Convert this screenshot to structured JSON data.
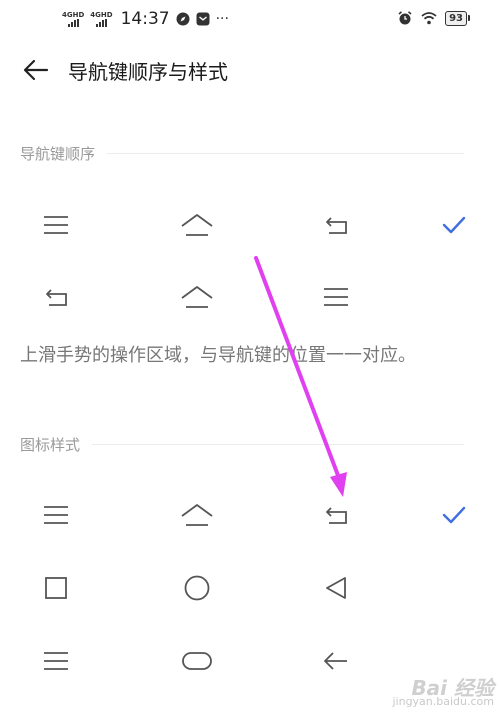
{
  "status_bar": {
    "network_1": "4GHD",
    "network_2": "4GHD",
    "time": "14:37",
    "more": "···",
    "battery": "93"
  },
  "header": {
    "title": "导航键顺序与样式",
    "back_icon": "arrow-left-icon"
  },
  "order_section": {
    "title": "导航键顺序",
    "options": [
      {
        "buttons": [
          "menu-icon",
          "home-icon",
          "back-icon"
        ],
        "selected": true
      },
      {
        "buttons": [
          "back-icon",
          "home-icon",
          "menu-icon"
        ],
        "selected": false
      }
    ]
  },
  "hint": "上滑手势的操作区域，与导航键的位置一一对应。",
  "style_section": {
    "title": "图标样式",
    "options": [
      {
        "buttons": [
          "menu-icon",
          "home-icon",
          "back-icon"
        ],
        "selected": true
      },
      {
        "buttons": [
          "square-icon",
          "circle-icon",
          "triangle-left-icon"
        ],
        "selected": false
      },
      {
        "buttons": [
          "menu-icon",
          "pill-icon",
          "arrow-left-icon"
        ],
        "selected": false
      }
    ]
  },
  "watermark": {
    "logo": "Bai 经验",
    "url": "jingyan.baidu.com"
  },
  "colors": {
    "accent": "#3f6fe0",
    "annotation_arrow": "#e040f0",
    "icon": "#555555"
  }
}
